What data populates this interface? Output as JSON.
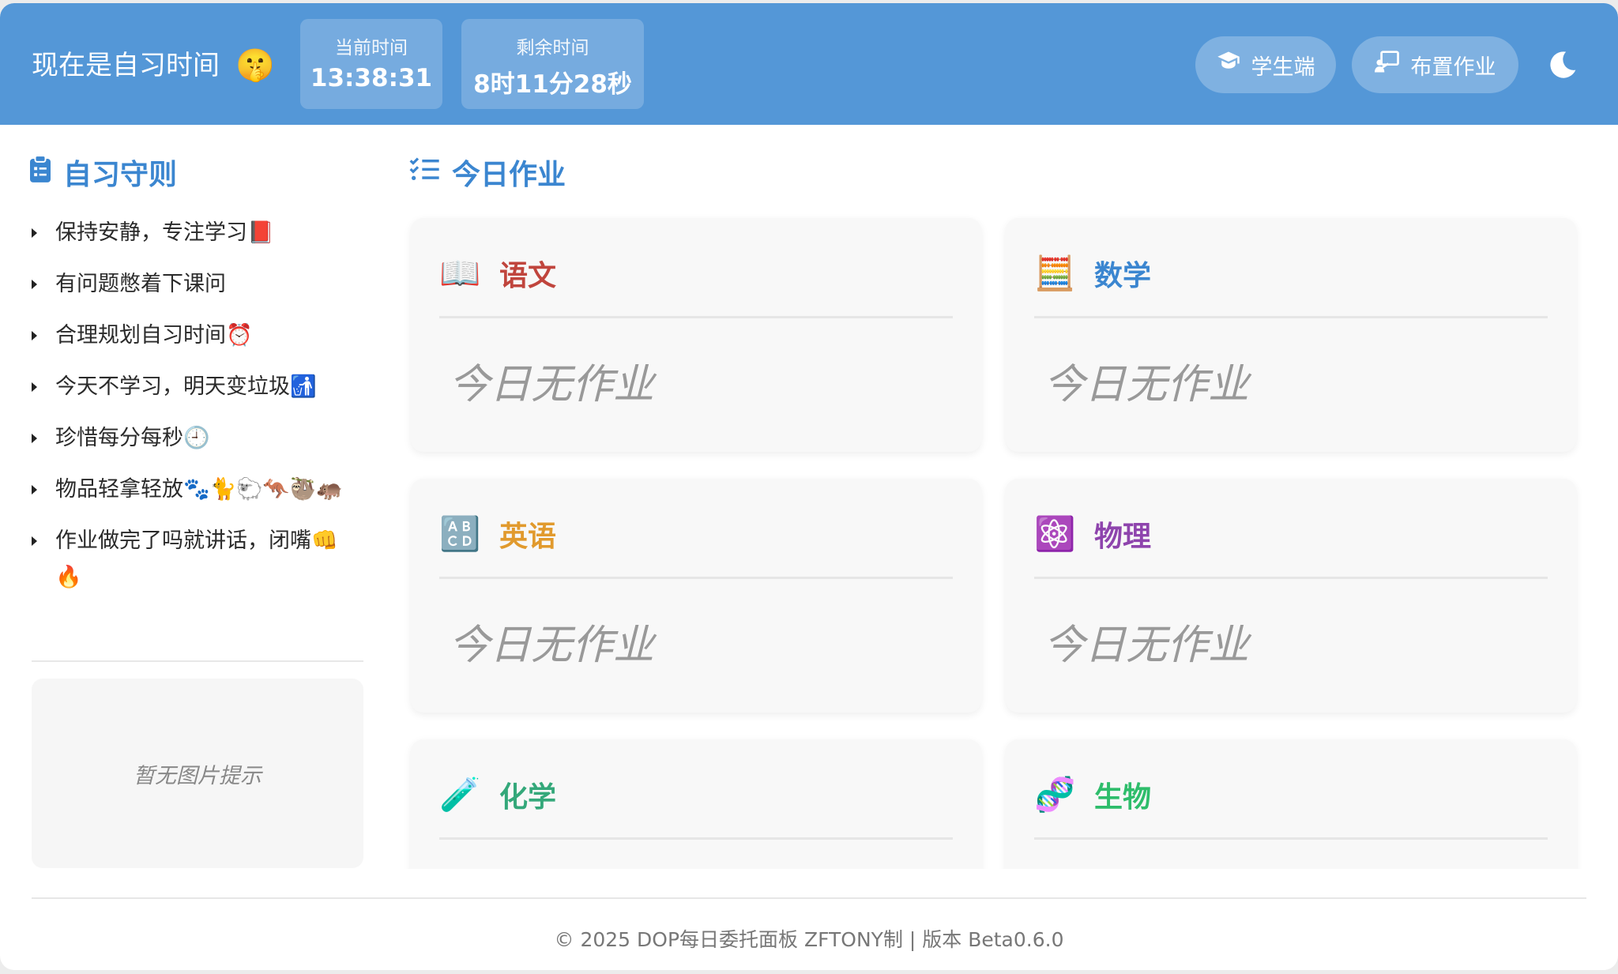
{
  "header": {
    "status_text": "现在是自习时间",
    "status_emoji": "🤫",
    "current_time_label": "当前时间",
    "current_time_value": "13:38:31",
    "remaining_time_label": "剩余时间",
    "remaining_time_value": "8时11分28秒",
    "student_button_label": "学生端",
    "assign_button_label": "布置作业",
    "theme_toggle_icon": "moon-icon",
    "bg_color": "#5497d7"
  },
  "sidebar": {
    "title": "自习守则",
    "rules": [
      "保持安静，专注学习📕",
      "有问题憋着下课问",
      "合理规划自习时间⏰",
      "今天不学习，明天变垃圾🚮",
      "珍惜每分每秒🕘",
      "物品轻拿轻放🐾🐈🐑🦘🦥🦛",
      "作业做完了吗就讲话，闭嘴👊🔥"
    ],
    "image_placeholder": "暂无图片提示"
  },
  "main": {
    "title": "今日作业",
    "cards": [
      {
        "subject": "语文",
        "icon": "📖",
        "color": "#c0453d",
        "content": "今日无作业"
      },
      {
        "subject": "数学",
        "icon": "🧮",
        "color": "#3b86d0",
        "content": "今日无作业"
      },
      {
        "subject": "英语",
        "icon": "🔠",
        "color": "#e19a2d",
        "content": "今日无作业"
      },
      {
        "subject": "物理",
        "icon": "⚛️",
        "color": "#8e44ad",
        "content": "今日无作业"
      },
      {
        "subject": "化学",
        "icon": "🧪",
        "color": "#34a87a",
        "content": ""
      },
      {
        "subject": "生物",
        "icon": "🧬",
        "color": "#2ebd6b",
        "content": ""
      }
    ]
  },
  "footer": {
    "text": "© 2025 DOP每日委托面板 ZFTONY制 | 版本 Beta0.6.0"
  }
}
